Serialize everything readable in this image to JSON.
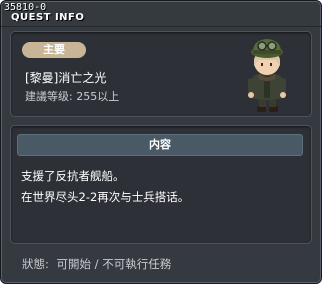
{
  "window": {
    "quest_id": "35810-0",
    "title": "QUEST INFO"
  },
  "quest": {
    "category": "主要",
    "name": "[黎曼]消亡之光",
    "level_requirement": "建議等级: 255以上",
    "npc_icon": "soldier-portrait"
  },
  "content": {
    "header": "内容",
    "lines": [
      "支援了反抗者舰船。",
      "在世界尽头2-2再次与士兵搭话。"
    ]
  },
  "status": {
    "label": "狀態:",
    "value": "可開始 / 不可執行任務"
  },
  "colors": {
    "window_bg": "#353a41",
    "panel_bg": "#2d3137",
    "badge_bg": "#c7b596",
    "header_bg": "#4a5966"
  }
}
